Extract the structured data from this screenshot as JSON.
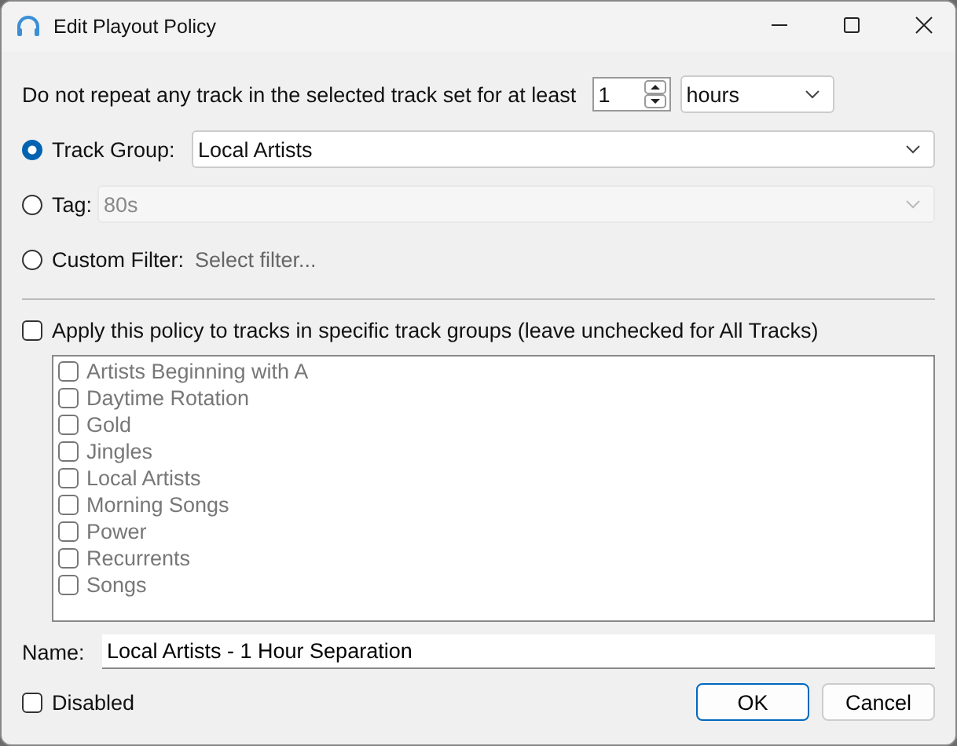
{
  "window": {
    "title": "Edit Playout Policy"
  },
  "repeat": {
    "label": "Do not repeat any track in the selected track set for at least",
    "value": "1",
    "unit": "hours"
  },
  "sources": [
    {
      "label": "Track Group:",
      "selected": true,
      "kind": "combo",
      "value": "Local Artists",
      "disabled": false
    },
    {
      "label": "Tag:",
      "selected": false,
      "kind": "combo",
      "value": "80s",
      "disabled": true
    },
    {
      "label": "Custom Filter:",
      "selected": false,
      "kind": "link",
      "value": "Select filter..."
    }
  ],
  "apply": {
    "label": "Apply this policy to tracks in specific track groups (leave unchecked for All Tracks)",
    "checked": false
  },
  "groups": {
    "disabled": true,
    "items": [
      {
        "label": "Artists Beginning with A",
        "checked": false
      },
      {
        "label": "Daytime Rotation",
        "checked": false
      },
      {
        "label": "Gold",
        "checked": false
      },
      {
        "label": "Jingles",
        "checked": false
      },
      {
        "label": "Local Artists",
        "checked": false
      },
      {
        "label": "Morning Songs",
        "checked": false
      },
      {
        "label": "Power",
        "checked": false
      },
      {
        "label": "Recurrents",
        "checked": false
      },
      {
        "label": "Songs",
        "checked": false
      }
    ]
  },
  "name": {
    "label": "Name:",
    "value": "Local Artists - 1 Hour Separation"
  },
  "disabled": {
    "label": "Disabled",
    "checked": false
  },
  "buttons": [
    {
      "label": "OK",
      "default": true
    },
    {
      "label": "Cancel",
      "default": false
    }
  ]
}
